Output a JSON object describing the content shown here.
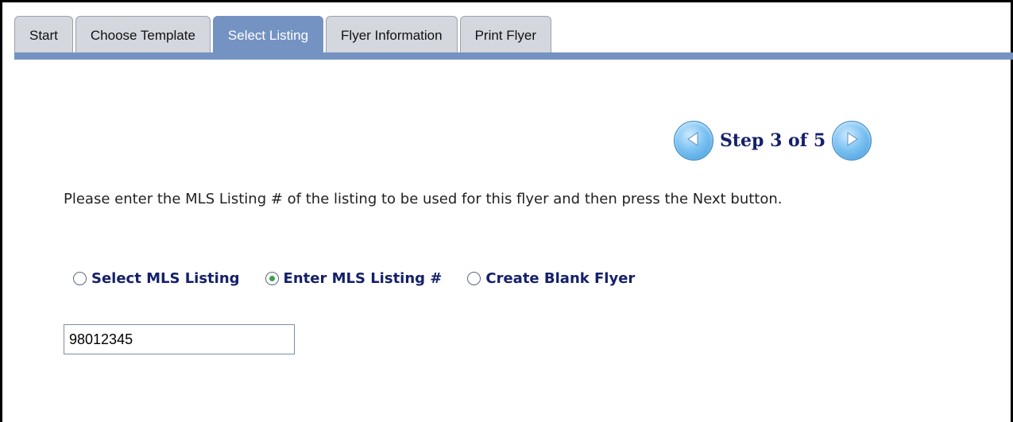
{
  "tabs": [
    {
      "label": "Start",
      "active": false
    },
    {
      "label": "Choose Template",
      "active": false
    },
    {
      "label": "Select Listing",
      "active": true
    },
    {
      "label": "Flyer Information",
      "active": false
    },
    {
      "label": "Print Flyer",
      "active": false
    }
  ],
  "step": {
    "text": "Step 3 of 5",
    "prev_icon": "arrow-left-icon",
    "next_icon": "arrow-right-icon"
  },
  "instructions": "Please enter the MLS Listing # of the listing to be used for this flyer and then press the Next button.",
  "radio_options": [
    {
      "label": "Select MLS Listing",
      "selected": false
    },
    {
      "label": "Enter MLS Listing #",
      "selected": true
    },
    {
      "label": "Create Blank Flyer",
      "selected": false
    }
  ],
  "mls_input": {
    "value": "98012345"
  },
  "colors": {
    "tab_active": "#7593c2",
    "tab_inactive": "#d4d7de",
    "label_text": "#14206a",
    "radio_selected": "#3e9e48"
  }
}
